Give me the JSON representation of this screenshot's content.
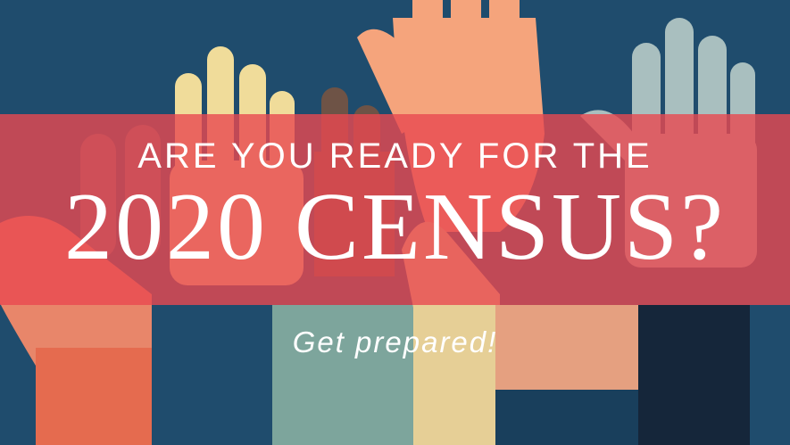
{
  "banner": {
    "headline_small": "ARE YOU READY FOR THE",
    "headline_large": "2020 CENSUS?",
    "tagline": "Get prepared!"
  },
  "colors": {
    "background": "#1f4c6d",
    "banner": "#e84850",
    "text": "#ffffff"
  }
}
